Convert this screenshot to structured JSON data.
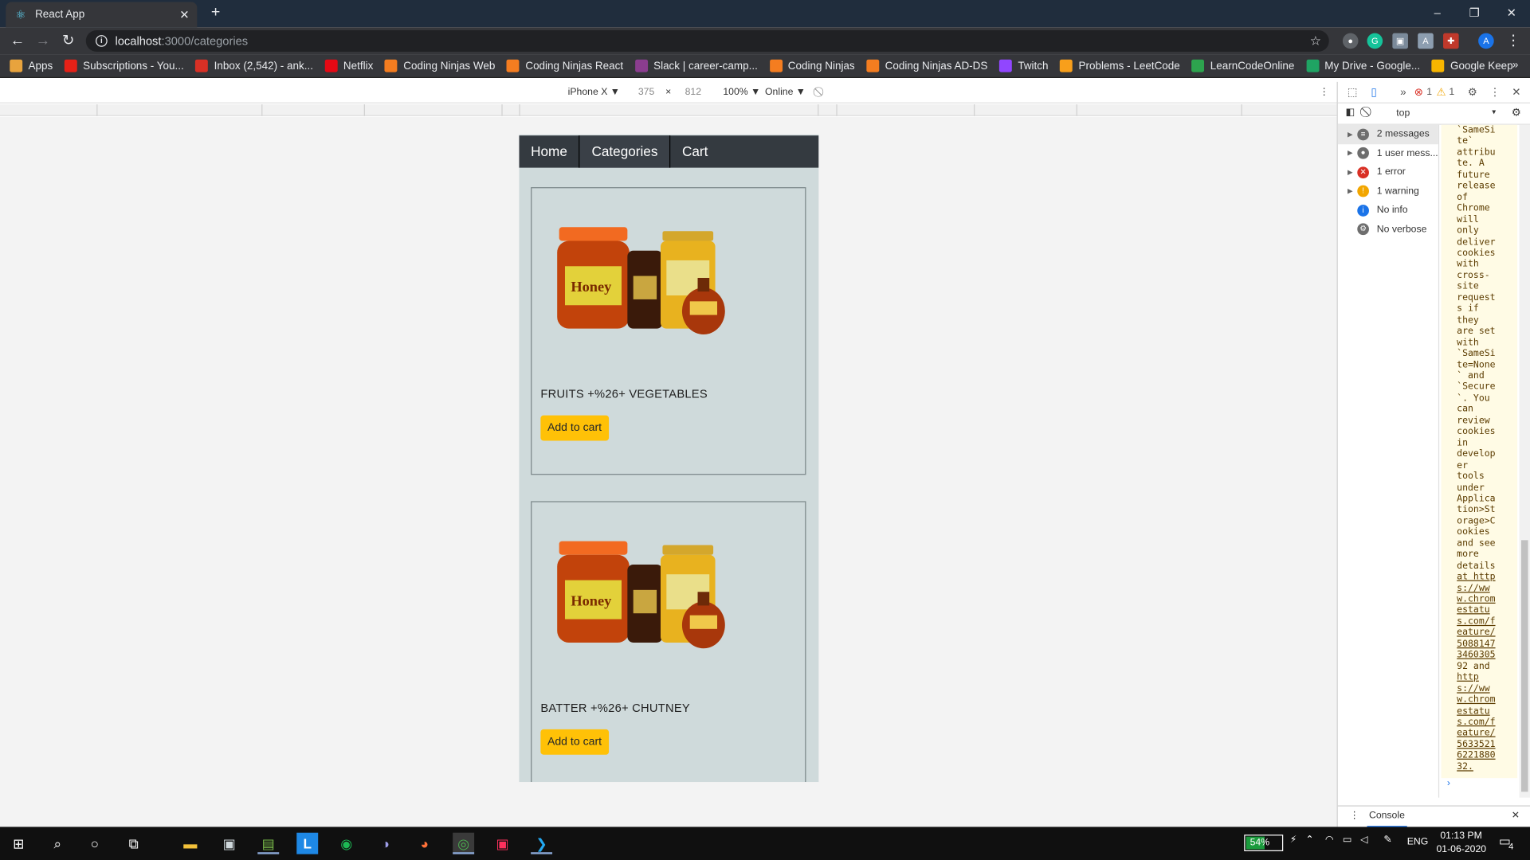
{
  "browser": {
    "tab_title": "React App",
    "tab_close": "✕",
    "new_tab": "+",
    "window_controls": {
      "minimize": "–",
      "maximize": "❐",
      "close": "✕"
    },
    "url_host": "localhost",
    "url_path": ":3000/categories",
    "profile_initial": "A",
    "bookmarks": [
      {
        "label": "Apps",
        "icon": "apps-grid-icon",
        "color": "#e8a33d"
      },
      {
        "label": "Subscriptions - You...",
        "icon": "youtube-icon",
        "color": "#e62117"
      },
      {
        "label": "Inbox (2,542) - ank...",
        "icon": "gmail-icon",
        "color": "#d93025"
      },
      {
        "label": "Netflix",
        "icon": "netflix-icon",
        "color": "#e50914"
      },
      {
        "label": "Coding Ninjas Web",
        "icon": "coding-ninjas-icon",
        "color": "#f47d20"
      },
      {
        "label": "Coding Ninjas React",
        "icon": "coding-ninjas-icon",
        "color": "#f47d20"
      },
      {
        "label": "Slack | career-camp...",
        "icon": "slack-icon",
        "color": "#8b3d8f"
      },
      {
        "label": "Coding Ninjas",
        "icon": "coding-ninjas-icon",
        "color": "#f47d20"
      },
      {
        "label": "Coding Ninjas AD-DS",
        "icon": "coding-ninjas-icon",
        "color": "#f47d20"
      },
      {
        "label": "Twitch",
        "icon": "twitch-icon",
        "color": "#9146ff"
      },
      {
        "label": "Problems - LeetCode",
        "icon": "leetcode-icon",
        "color": "#f89f1b"
      },
      {
        "label": "LearnCodeOnline",
        "icon": "learncodeonline-icon",
        "color": "#2da44e"
      },
      {
        "label": "My Drive - Google...",
        "icon": "google-drive-icon",
        "color": "#1fa463"
      },
      {
        "label": "Google Keep",
        "icon": "google-keep-icon",
        "color": "#f7b500"
      }
    ],
    "bookmarks_overflow": "»"
  },
  "device_toolbar": {
    "device": "iPhone X ▼",
    "width": "375",
    "times": "×",
    "height": "812",
    "zoom": "100% ▼",
    "network": "Online ▼"
  },
  "app": {
    "nav": [
      {
        "label": "Home",
        "active": false
      },
      {
        "label": "Categories",
        "active": true
      },
      {
        "label": "Cart",
        "active": false
      }
    ],
    "categories": [
      {
        "title": "FRUITS +%26+ VEGETABLES",
        "button": "Add to cart"
      },
      {
        "title": "BATTER +%26+ CHUTNEY",
        "button": "Add to cart"
      }
    ]
  },
  "devtools": {
    "error_count": "1",
    "warning_count": "1",
    "context": "top",
    "sidebar": [
      {
        "label": "2 messages",
        "icon": "list-icon",
        "color": "#6e6e6e"
      },
      {
        "label": "1 user mess...",
        "icon": "user-icon",
        "color": "#6e6e6e"
      },
      {
        "label": "1 error",
        "icon": "error-icon",
        "color": "#d93025"
      },
      {
        "label": "1 warning",
        "icon": "warning-icon",
        "color": "#f2a600"
      },
      {
        "label": "No info",
        "icon": "info-icon",
        "color": "#1a73e8"
      },
      {
        "label": "No verbose",
        "icon": "gear-icon",
        "color": "#6e6e6e"
      }
    ],
    "console_lines": [
      "`SameSi",
      "te`",
      "attribu",
      "te. A",
      "future",
      "release",
      "of",
      "Chrome",
      "will",
      "only",
      "deliver",
      "cookies",
      "with",
      "cross-",
      "site",
      "request",
      "s if",
      "they",
      "are set",
      "with",
      "`SameSi",
      "te=None",
      "` and",
      "`Secure",
      "`. You",
      "can",
      "review",
      "cookies",
      "in",
      "develop",
      "er",
      "tools",
      "under",
      "Applica",
      "tion>St",
      "orage>C",
      "ookies",
      "and see",
      "more",
      "details",
      "at http",
      "s://ww",
      "w.chrom",
      "estatu",
      "s.com/f",
      "eature/",
      "5088147",
      "3460305",
      "92 and",
      "http",
      "s://ww",
      "w.chrom",
      "estatu",
      "s.com/f",
      "eature/",
      "5633521",
      "6221880",
      "32."
    ],
    "prompt": "›",
    "drawer_tab": "Console",
    "drawer_close": "✕"
  },
  "taskbar": {
    "battery": "54%",
    "language": "ENG",
    "time": "01:13 PM",
    "date": "01-06-2020",
    "notifications": "4"
  }
}
